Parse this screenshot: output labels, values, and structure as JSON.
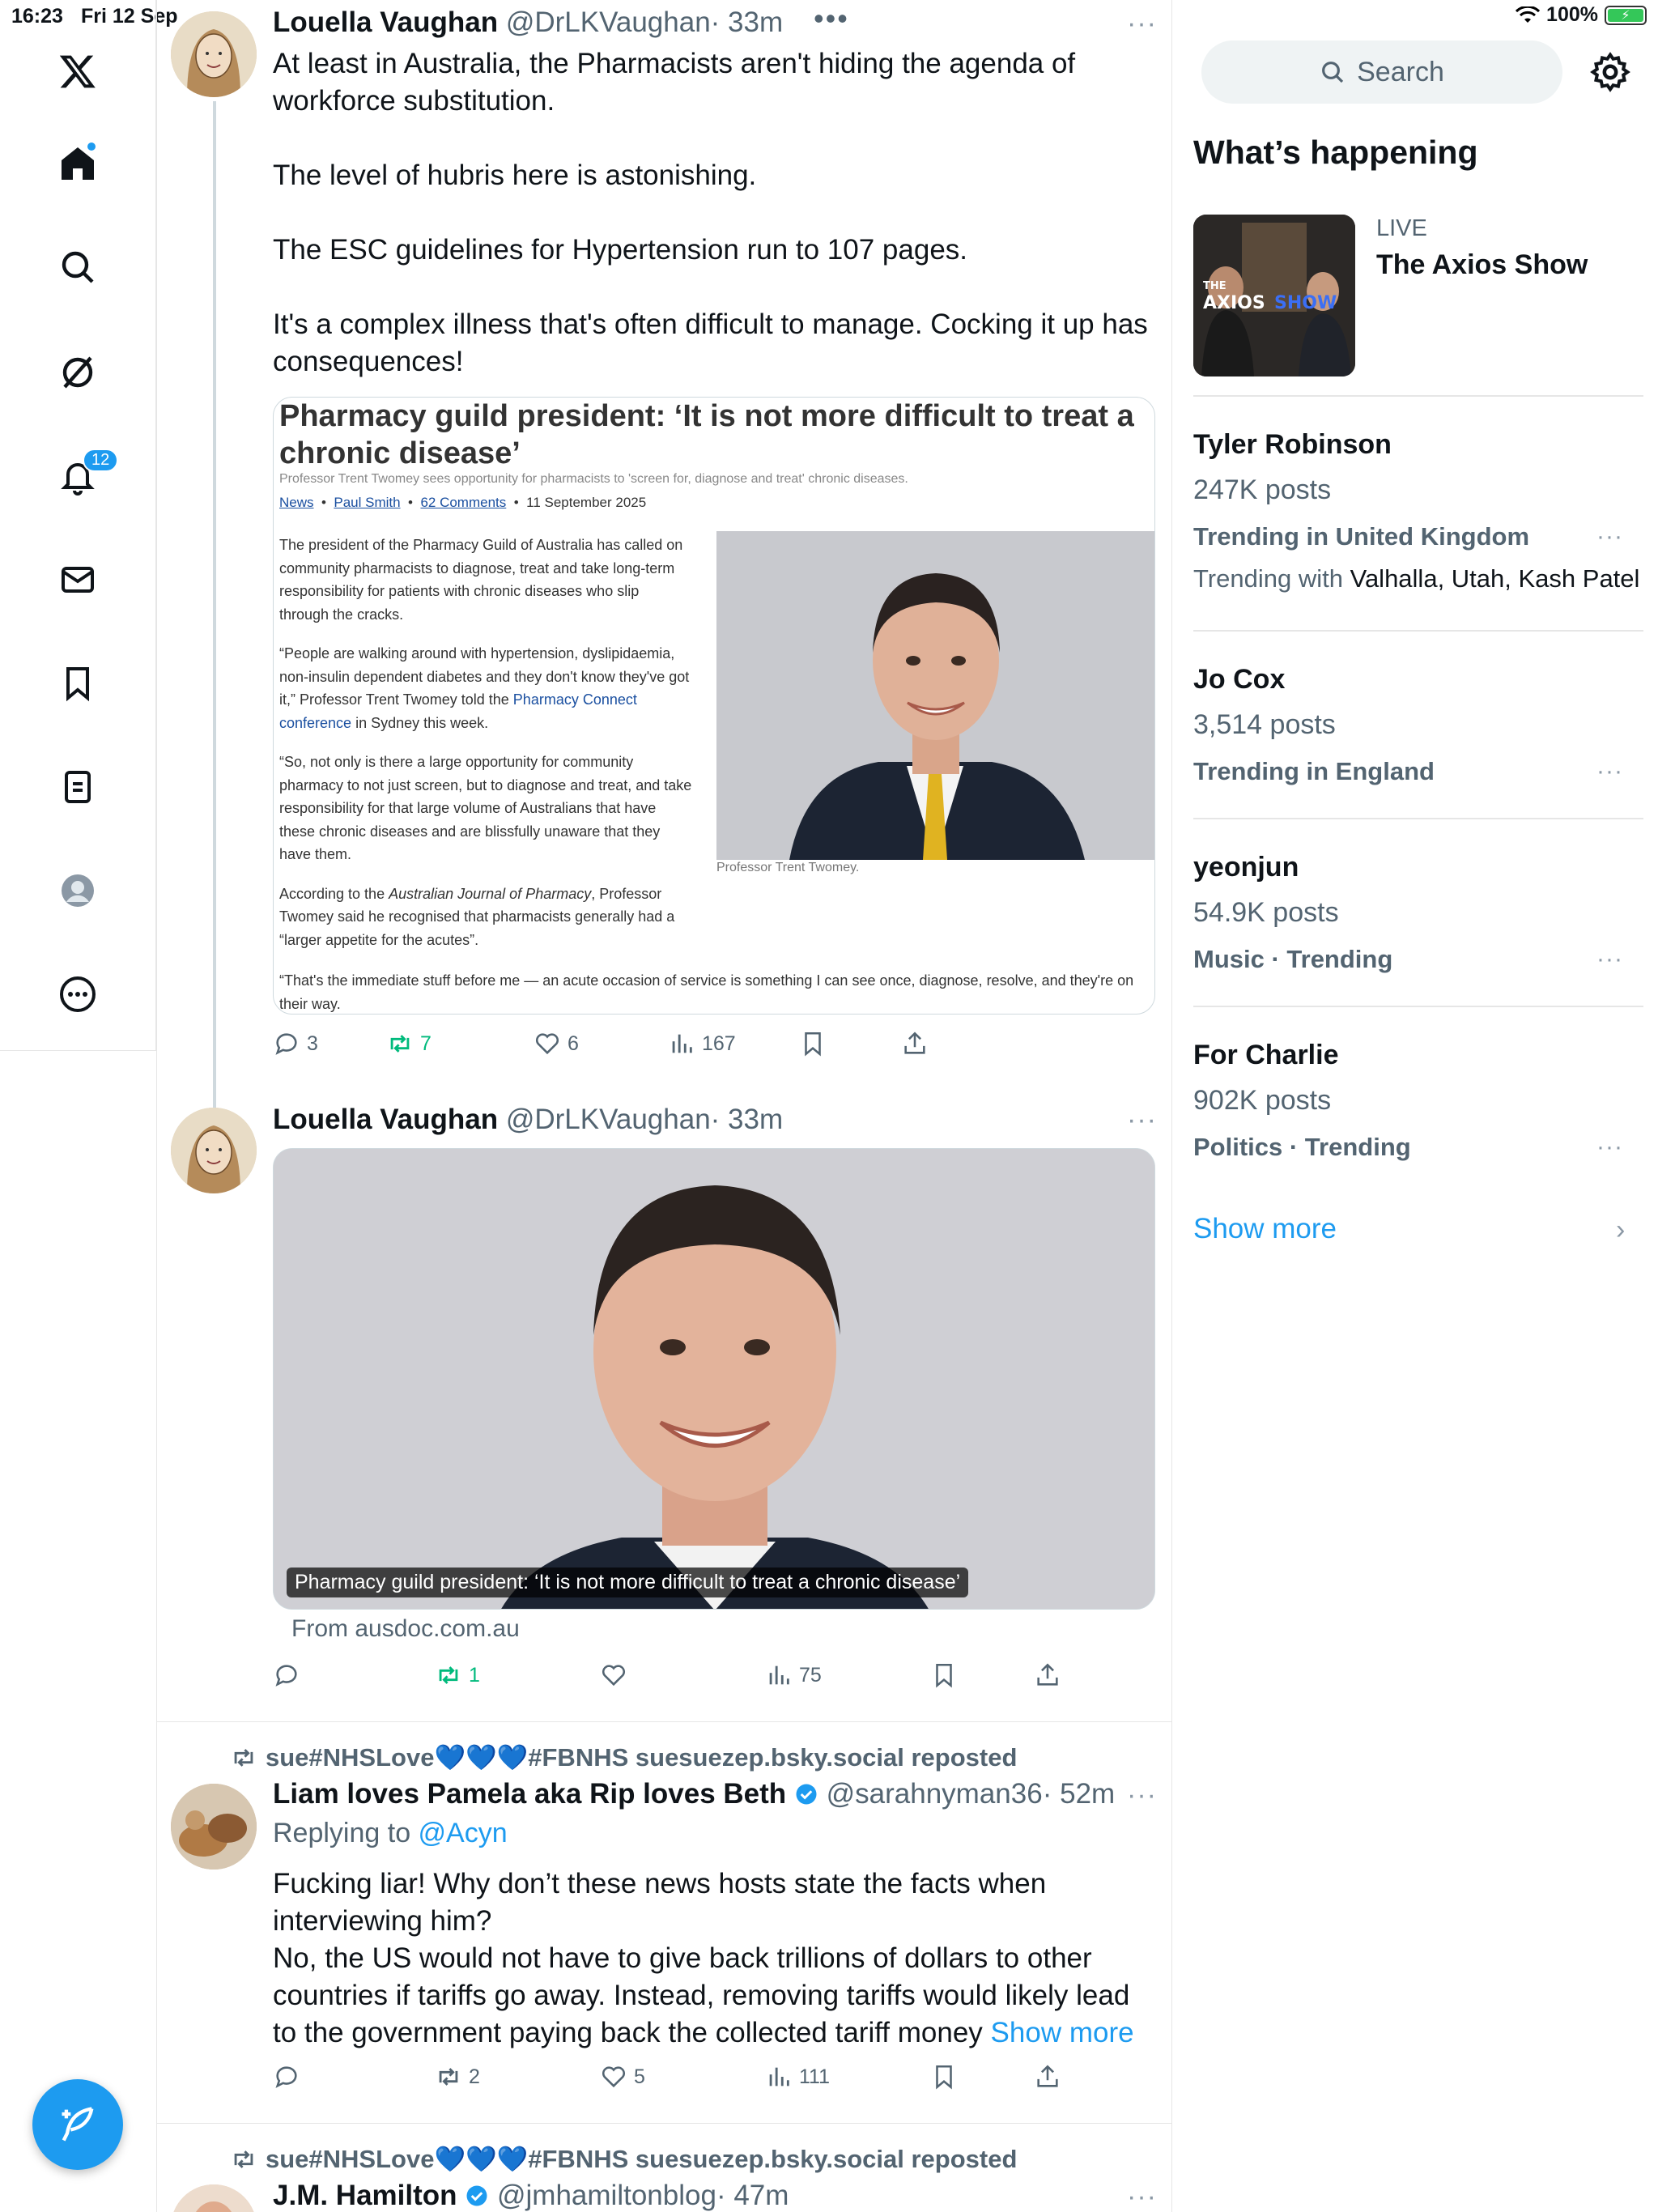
{
  "status_bar": {
    "time": "16:23",
    "date": "Fri 12 Sep",
    "wifi_icon": "wifi-icon",
    "battery": "100%"
  },
  "nav": {
    "notifications_badge": "12"
  },
  "tweet1": {
    "name": "Louella Vaughan",
    "handle": "@DrLKVaughan",
    "time": "· 33m",
    "paragraphs": [
      "At least in Australia, the Pharmacists aren't hiding the agenda of workforce substitution.",
      "The level of hubris here is astonishing.",
      "The ESC guidelines for Hypertension run to 107 pages.",
      "It's a complex illness that's often difficult to manage. Cocking it up has consequences!"
    ],
    "article": {
      "title": "Pharmacy guild president: ‘It is not more difficult to treat a chronic disease’",
      "subtitle": "Professor Trent Twomey sees opportunity for pharmacists to 'screen for, diagnose and treat' chronic diseases.",
      "meta_section": "News",
      "meta_author": "Paul Smith",
      "meta_comments": "62 Comments",
      "meta_date": "11 September 2025",
      "p1": "The president of the Pharmacy Guild of Australia has called on community pharmacists to diagnose, treat and take long-term responsibility for patients with chronic diseases who slip through the cracks.",
      "p2_before": "“People are walking around with hypertension, dyslipidaemia, non-insulin dependent diabetes and they don't know they've got it,” Professor Trent Twomey told the ",
      "p2_link": "Pharmacy Connect conference",
      "p2_after": " in Sydney this week.",
      "p3": "“So, not only is there a large opportunity for community pharmacy to not just screen, but to diagnose and treat, and take responsibility for that large volume of Australians that have these chronic diseases and are blissfully unaware that they have them.",
      "p4_before": "According to the ",
      "p4_italic": "Australian Journal of Pharmacy",
      "p4_after": ", Professor Twomey said he recognised that pharmacists generally had a “larger appetite for the acutes”.",
      "p5": "“That's the immediate stuff before me — an acute occasion of service is something I can see once, diagnose, resolve, and they're on their way.",
      "photo_caption": "Professor Trent Twomey."
    },
    "replies": "3",
    "reposts": "7",
    "likes": "6",
    "views": "167"
  },
  "tweet2": {
    "name": "Louella Vaughan",
    "handle": "@DrLKVaughan",
    "time": "· 33m",
    "card_caption": "Pharmacy guild president: ‘It is not more difficult to treat a chronic disease’",
    "from": "From ausdoc.com.au",
    "replies": "",
    "reposts": "1",
    "likes": "",
    "views": "75"
  },
  "tweet3": {
    "repost_by": "sue#NHSLove💙💙💙#FBNHS suesuezep.bsky.social reposted",
    "name": "Liam loves Pamela aka Rip loves Beth",
    "handle": "@sarahnyman36",
    "time": "· 52m",
    "replying_label": "Replying to ",
    "replying_to": "@Acyn",
    "text": "Fucking liar! Why don’t these news hosts state the facts when interviewing him?\nNo, the US would not have to give back trillions of dollars to other countries if tariffs go away. Instead, removing tariffs would likely lead to the government paying back the collected tariff money ",
    "show_more": "Show more",
    "replies": "",
    "reposts": "2",
    "likes": "5",
    "views": "111"
  },
  "tweet4": {
    "repost_by": "sue#NHSLove💙💙💙#FBNHS suesuezep.bsky.social reposted",
    "name": "J.M. Hamilton",
    "handle": "@jmhamiltonblog",
    "time": "· 47m"
  },
  "sidebar": {
    "search_placeholder": "Search",
    "whats_happening": "What’s happening",
    "live_label": "LIVE",
    "live_title": "The Axios Show",
    "live_thumb_text_small": "THE",
    "live_thumb_text_big": "AXIOS",
    "live_thumb_text_blue": "SHOW",
    "trends": [
      {
        "name": "Tyler Robinson",
        "posts": "247K posts",
        "context": "Trending in United Kingdom",
        "with_label": "Trending with ",
        "with": "Valhalla, Utah, Kash Patel"
      },
      {
        "name": "Jo Cox",
        "posts": "3,514 posts",
        "context": "Trending in England"
      },
      {
        "name": "yeonjun",
        "posts": "54.9K posts",
        "context": "Music · Trending"
      },
      {
        "name": "For Charlie",
        "posts": "902K posts",
        "context": "Politics · Trending"
      }
    ],
    "show_more": "Show more"
  },
  "colors": {
    "accent": "#1d9bf0",
    "repost_green": "#00ba7c",
    "secondary_text": "#536471",
    "border": "#e6e6e6"
  }
}
